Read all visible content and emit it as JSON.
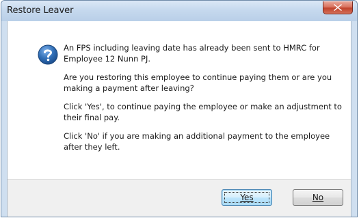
{
  "window": {
    "title": "Restore Leaver"
  },
  "dialog": {
    "icon": "question-icon",
    "messages": [
      "An FPS including leaving date has already been sent to HMRC for Employee 12 Nunn PJ.",
      "Are you restoring this employee to continue paying them or are you making a payment after leaving?",
      "Click 'Yes', to continue paying the employee or make an adjustment to their final pay.",
      "Click 'No' if you are making an additional payment to the employee after they left."
    ]
  },
  "buttons": {
    "yes_label": "Yes",
    "no_label": "No"
  },
  "colors": {
    "titlebar": "#c6d9ee",
    "close_button": "#c0432c",
    "icon_blue": "#2f6db5",
    "button_bar": "#f0f0f0"
  }
}
